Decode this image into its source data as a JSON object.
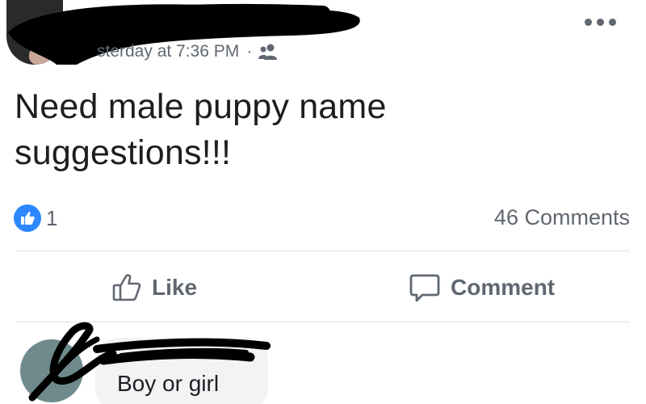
{
  "post": {
    "timestamp": "sterday at 7:36 PM",
    "separator": "·",
    "audience_icon": "group-icon",
    "more_icon": "more-options-icon",
    "text_line1": "Need male puppy name",
    "text_line2": "suggestions!!!"
  },
  "stats": {
    "like_count": "1",
    "comments_label": "46 Comments"
  },
  "actions": {
    "like_label": "Like",
    "comment_label": "Comment"
  },
  "comment": {
    "text": "Boy or girl"
  },
  "colors": {
    "like_blue": "#2d88ff",
    "text_primary": "#1c1e21",
    "text_secondary": "#616770",
    "bubble_bg": "#f2f3f5",
    "redaction": "#000000"
  }
}
